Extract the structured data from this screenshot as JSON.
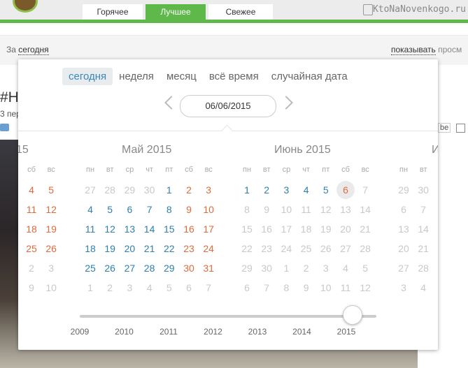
{
  "header": {
    "tabs": [
      {
        "label": "Горячее",
        "active": false
      },
      {
        "label": "Лучшее",
        "active": true
      },
      {
        "label": "Свежее",
        "active": false
      }
    ],
    "site": "KtoNaNovenkogo.ru"
  },
  "filter": {
    "prefix": "За",
    "period": "сегодня",
    "show_link": "показывать",
    "show_rest": "просм"
  },
  "background": {
    "title": "#На",
    "sub": "3 пер",
    "badge": "be"
  },
  "popup": {
    "periods": [
      "сегодня",
      "неделя",
      "месяц",
      "всё время",
      "случайная дата"
    ],
    "active_period": "сегодня",
    "date_value": "06/06/2015",
    "months": [
      {
        "title": "15",
        "dows": [
          "сб",
          "вс"
        ],
        "rows": [
          [
            {
              "d": "4",
              "t": "we"
            },
            {
              "d": "5",
              "t": "we"
            }
          ],
          [
            {
              "d": "11",
              "t": "we"
            },
            {
              "d": "12",
              "t": "we"
            }
          ],
          [
            {
              "d": "18",
              "t": "we"
            },
            {
              "d": "19",
              "t": "we"
            }
          ],
          [
            {
              "d": "25",
              "t": "we"
            },
            {
              "d": "26",
              "t": "we"
            }
          ],
          [
            {
              "d": "2",
              "t": "dim"
            },
            {
              "d": "3",
              "t": "dim"
            }
          ],
          [
            {
              "d": "9",
              "t": "dim"
            },
            {
              "d": "10",
              "t": "dim"
            }
          ]
        ]
      },
      {
        "title": "Май 2015",
        "dows": [
          "пн",
          "вт",
          "ср",
          "чт",
          "пт",
          "сб",
          "вс"
        ],
        "rows": [
          [
            {
              "d": "27",
              "t": "dim"
            },
            {
              "d": "28",
              "t": "dim"
            },
            {
              "d": "29",
              "t": "dim"
            },
            {
              "d": "30",
              "t": "dim"
            },
            {
              "d": "1",
              "t": "wd"
            },
            {
              "d": "2",
              "t": "we"
            },
            {
              "d": "3",
              "t": "we"
            }
          ],
          [
            {
              "d": "4",
              "t": "wd"
            },
            {
              "d": "5",
              "t": "wd"
            },
            {
              "d": "6",
              "t": "wd"
            },
            {
              "d": "7",
              "t": "wd"
            },
            {
              "d": "8",
              "t": "wd"
            },
            {
              "d": "9",
              "t": "we"
            },
            {
              "d": "10",
              "t": "we"
            }
          ],
          [
            {
              "d": "11",
              "t": "wd"
            },
            {
              "d": "12",
              "t": "wd"
            },
            {
              "d": "13",
              "t": "wd"
            },
            {
              "d": "14",
              "t": "wd"
            },
            {
              "d": "15",
              "t": "wd"
            },
            {
              "d": "16",
              "t": "we"
            },
            {
              "d": "17",
              "t": "we"
            }
          ],
          [
            {
              "d": "18",
              "t": "wd"
            },
            {
              "d": "19",
              "t": "wd"
            },
            {
              "d": "20",
              "t": "wd"
            },
            {
              "d": "21",
              "t": "wd"
            },
            {
              "d": "22",
              "t": "wd"
            },
            {
              "d": "23",
              "t": "we"
            },
            {
              "d": "24",
              "t": "we"
            }
          ],
          [
            {
              "d": "25",
              "t": "wd"
            },
            {
              "d": "26",
              "t": "wd"
            },
            {
              "d": "27",
              "t": "wd"
            },
            {
              "d": "28",
              "t": "wd"
            },
            {
              "d": "29",
              "t": "wd"
            },
            {
              "d": "30",
              "t": "we"
            },
            {
              "d": "31",
              "t": "we"
            }
          ],
          [
            {
              "d": "1",
              "t": "dim"
            },
            {
              "d": "2",
              "t": "dim"
            },
            {
              "d": "3",
              "t": "dim"
            },
            {
              "d": "4",
              "t": "dim"
            },
            {
              "d": "5",
              "t": "dim"
            },
            {
              "d": "6",
              "t": "dim"
            },
            {
              "d": "7",
              "t": "dim"
            }
          ]
        ]
      },
      {
        "title": "Июнь 2015",
        "dows": [
          "пн",
          "вт",
          "ср",
          "чт",
          "пт",
          "сб",
          "вс"
        ],
        "rows": [
          [
            {
              "d": "1",
              "t": "wd"
            },
            {
              "d": "2",
              "t": "wd"
            },
            {
              "d": "3",
              "t": "wd"
            },
            {
              "d": "4",
              "t": "wd"
            },
            {
              "d": "5",
              "t": "wd"
            },
            {
              "d": "6",
              "t": "we sel"
            },
            {
              "d": "7",
              "t": "dim"
            }
          ],
          [
            {
              "d": "8",
              "t": "dim"
            },
            {
              "d": "9",
              "t": "dim"
            },
            {
              "d": "10",
              "t": "dim"
            },
            {
              "d": "11",
              "t": "dim"
            },
            {
              "d": "12",
              "t": "dim"
            },
            {
              "d": "13",
              "t": "dim"
            },
            {
              "d": "14",
              "t": "dim"
            }
          ],
          [
            {
              "d": "15",
              "t": "dim"
            },
            {
              "d": "16",
              "t": "dim"
            },
            {
              "d": "17",
              "t": "dim"
            },
            {
              "d": "18",
              "t": "dim"
            },
            {
              "d": "19",
              "t": "dim"
            },
            {
              "d": "20",
              "t": "dim"
            },
            {
              "d": "21",
              "t": "dim"
            }
          ],
          [
            {
              "d": "22",
              "t": "dim"
            },
            {
              "d": "23",
              "t": "dim"
            },
            {
              "d": "24",
              "t": "dim"
            },
            {
              "d": "25",
              "t": "dim"
            },
            {
              "d": "26",
              "t": "dim"
            },
            {
              "d": "27",
              "t": "dim"
            },
            {
              "d": "28",
              "t": "dim"
            }
          ],
          [
            {
              "d": "29",
              "t": "dim"
            },
            {
              "d": "30",
              "t": "dim"
            },
            {
              "d": "1",
              "t": "dim"
            },
            {
              "d": "2",
              "t": "dim"
            },
            {
              "d": "3",
              "t": "dim"
            },
            {
              "d": "4",
              "t": "dim"
            },
            {
              "d": "5",
              "t": "dim"
            }
          ],
          [
            {
              "d": "6",
              "t": "dim"
            },
            {
              "d": "7",
              "t": "dim"
            },
            {
              "d": "8",
              "t": "dim"
            },
            {
              "d": "9",
              "t": "dim"
            },
            {
              "d": "10",
              "t": "dim"
            },
            {
              "d": "11",
              "t": "dim"
            },
            {
              "d": "12",
              "t": "dim"
            }
          ]
        ]
      },
      {
        "title": "И",
        "dows": [
          "пн",
          "вт"
        ],
        "rows": [
          [
            {
              "d": "29",
              "t": "dim"
            },
            {
              "d": "30",
              "t": "dim"
            }
          ],
          [
            {
              "d": "6",
              "t": "dim"
            },
            {
              "d": "7",
              "t": "dim"
            }
          ],
          [
            {
              "d": "13",
              "t": "dim"
            },
            {
              "d": "14",
              "t": "dim"
            }
          ],
          [
            {
              "d": "20",
              "t": "dim"
            },
            {
              "d": "21",
              "t": "dim"
            }
          ],
          [
            {
              "d": "27",
              "t": "dim"
            },
            {
              "d": "28",
              "t": "dim"
            }
          ],
          [
            {
              "d": "3",
              "t": "dim"
            },
            {
              "d": "4",
              "t": "dim"
            }
          ]
        ]
      }
    ],
    "years": [
      "2009",
      "2010",
      "2011",
      "2012",
      "2013",
      "2014",
      "2015"
    ],
    "slider_value": "2015",
    "colors": {
      "weekday": "#2d7fb0",
      "weekend": "#e06a3a",
      "accent": "#5eb84a"
    }
  }
}
